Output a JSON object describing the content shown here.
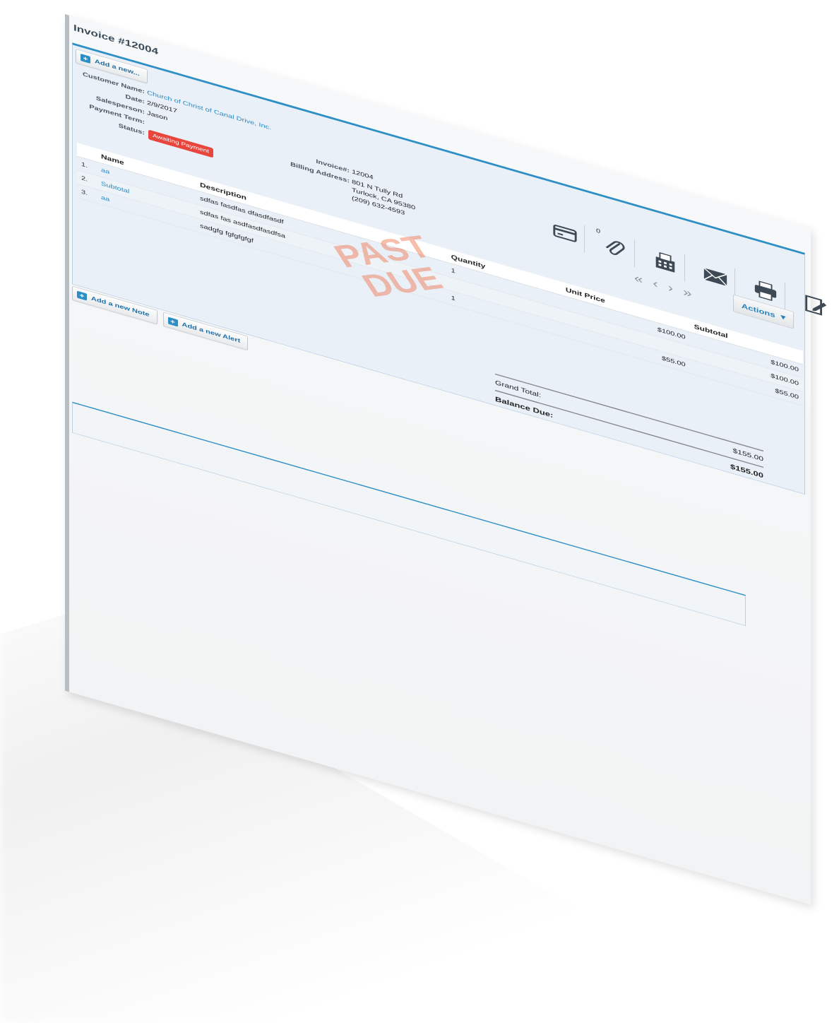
{
  "page_title": "Invoice #12004",
  "add_new_label": "Add a new...",
  "customer": {
    "name_label": "Customer Name:",
    "name_value": "Church of Christ of Canal Drive, Inc.",
    "date_label": "Date:",
    "date_value": "2/9/2017",
    "salesperson_label": "Salesperson:",
    "salesperson_value": "Jason",
    "payment_term_label": "Payment Term:",
    "status_label": "Status:",
    "status_value": "Awaiting Payment"
  },
  "invoice": {
    "number_label": "Invoice#:",
    "number_value": "12004",
    "billing_label": "Billing Address:",
    "billing_line1": "801 N Tully Rd",
    "billing_line2": "Turlock, CA 95380",
    "billing_line3": "(209) 632-4593"
  },
  "toolbar": {
    "attachment_count": "0",
    "icons": [
      "credit-card-icon",
      "paperclip-icon",
      "fax-icon",
      "envelope-icon",
      "printer-icon",
      "edit-icon"
    ],
    "pager": "« ‹ › »",
    "actions_label": "Actions"
  },
  "table": {
    "headers": [
      "Name",
      "Description",
      "Quantity",
      "Unit Price",
      "Subtotal"
    ],
    "rows": [
      {
        "num": "1.",
        "name": "aa",
        "description": "sdfas fasdfas dfasdfasdf",
        "quantity": "1",
        "unit_price": "$100.00",
        "subtotal": "$100.00"
      },
      {
        "num": "2.",
        "name": "Subtotal",
        "description": "sdfas fas asdfasdfasdfsa",
        "quantity": "",
        "unit_price": "",
        "subtotal": "$100.00"
      },
      {
        "num": "3.",
        "name": "aa",
        "description": "sadgfg fgfgfgfgf",
        "quantity": "1",
        "unit_price": "$55.00",
        "subtotal": "$55.00"
      }
    ]
  },
  "totals": {
    "grand_total_label": "Grand Total:",
    "grand_total_value": "$155.00",
    "balance_due_label": "Balance Due:",
    "balance_due_value": "$155.00"
  },
  "stamp": {
    "line1": "PAST",
    "line2": "DUE"
  },
  "bottom": {
    "add_note_label": "Add a new Note",
    "add_alert_label": "Add a new Alert"
  },
  "colors": {
    "accent": "#2d8fc4",
    "status": "#e8453c",
    "stamp": "#f06e46"
  }
}
